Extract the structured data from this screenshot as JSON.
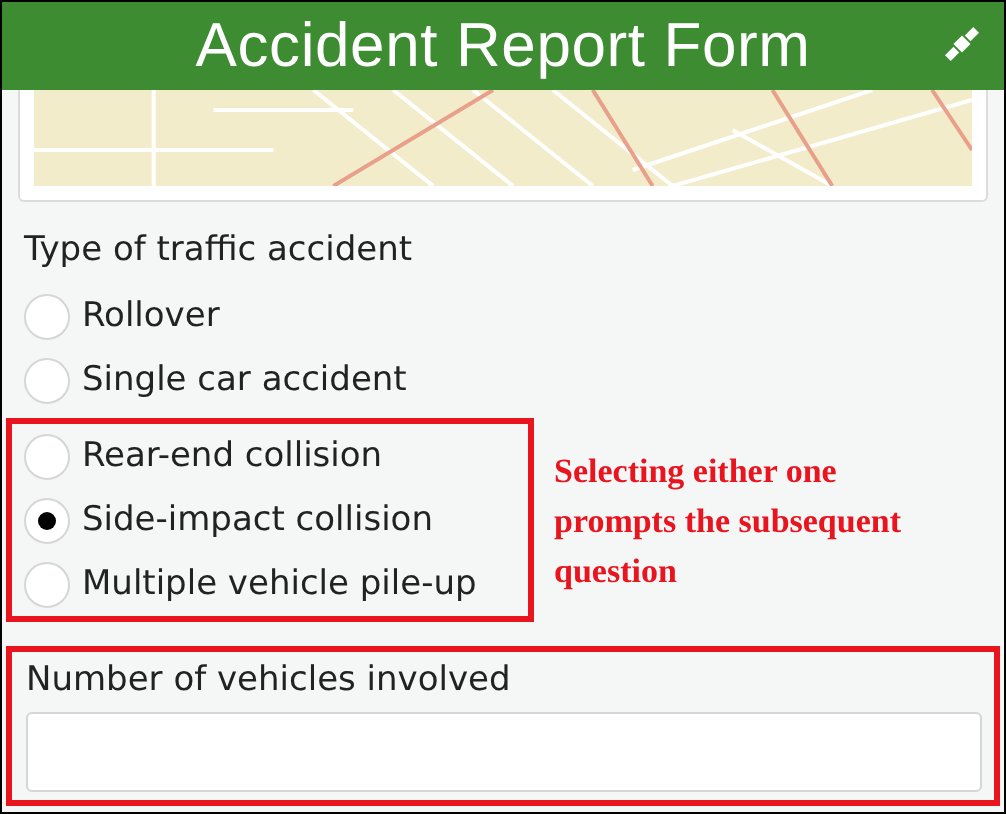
{
  "header": {
    "title": "Accident Report Form"
  },
  "question": {
    "label": "Type of traffic accident",
    "option_groups": [
      {
        "highlighted": false,
        "options": [
          {
            "label": "Rollover",
            "selected": false
          },
          {
            "label": "Single car accident",
            "selected": false
          }
        ]
      },
      {
        "highlighted": true,
        "callout": "Selecting either one prompts the subsequent question",
        "options": [
          {
            "label": "Rear-end collision",
            "selected": false
          },
          {
            "label": "Side-impact collision",
            "selected": true
          },
          {
            "label": "Multiple vehicle pile-up",
            "selected": false
          }
        ]
      }
    ]
  },
  "number_field": {
    "label": "Number of vehicles involved",
    "highlighted": true
  }
}
